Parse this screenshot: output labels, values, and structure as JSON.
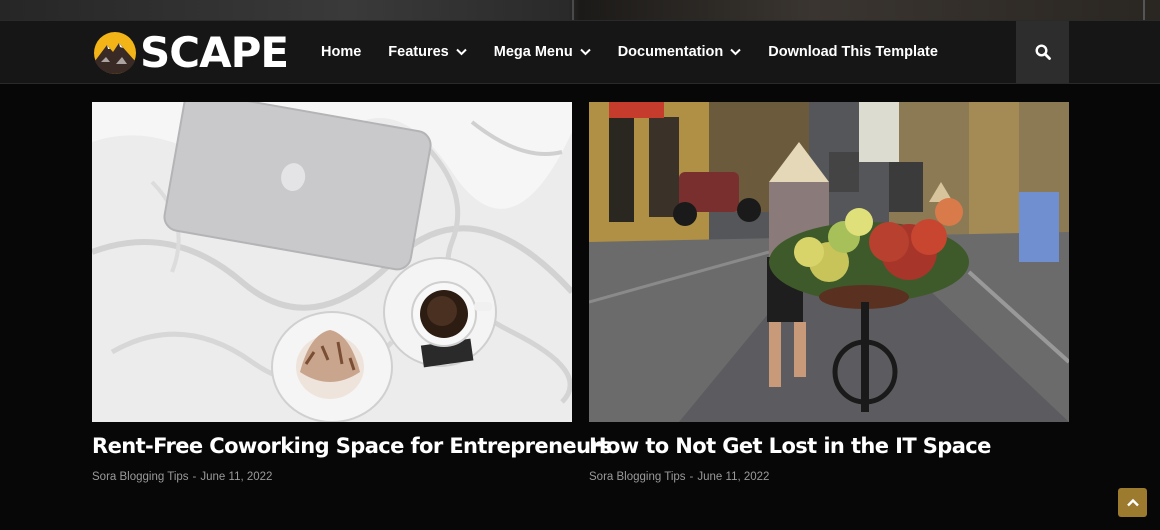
{
  "brand": {
    "logo_text": "SCAPE",
    "logo_icon": "mountain-badge-icon",
    "accent": "#f2b417"
  },
  "nav": {
    "items": [
      {
        "label": "Home",
        "has_dropdown": false
      },
      {
        "label": "Features",
        "has_dropdown": true
      },
      {
        "label": "Mega Menu",
        "has_dropdown": true
      },
      {
        "label": "Documentation",
        "has_dropdown": true
      },
      {
        "label": "Download This Template",
        "has_dropdown": false
      }
    ],
    "search_icon": "search-icon"
  },
  "posts": [
    {
      "title": "Rent-Free Coworking Space for Entrepreneurs",
      "author": "Sora Blogging Tips",
      "separator": "-",
      "date": "June 11, 2022",
      "image": "laptop-coffee-bed-photo"
    },
    {
      "title": "How to Not Get Lost in the IT Space",
      "author": "Sora Blogging Tips",
      "separator": "-",
      "date": "June 11, 2022",
      "image": "street-vendor-bicycle-photo"
    }
  ],
  "back_to_top": {
    "icon": "chevron-up-icon",
    "color": "#9c7a2e"
  }
}
